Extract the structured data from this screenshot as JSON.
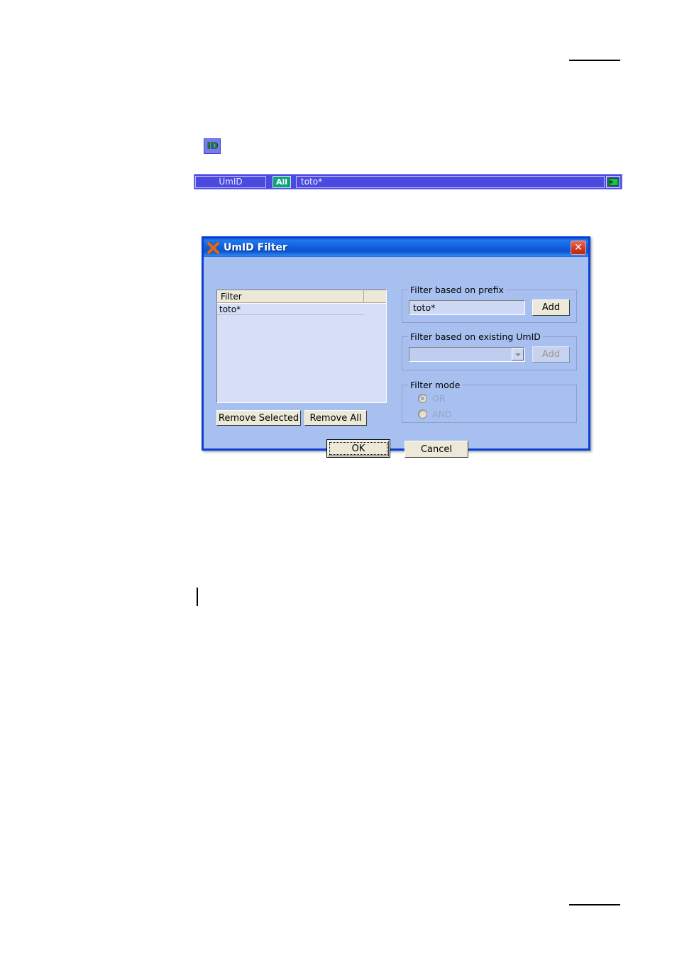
{
  "page": {
    "rules": [
      {
        "name": "top-rule"
      },
      {
        "name": "bottom-rule"
      }
    ],
    "change_bar": ""
  },
  "palette": {
    "id_button": {
      "label": "ID",
      "name": "id-icon",
      "bg": "#7a7aee",
      "fg": "#1f7a3f"
    }
  },
  "toolbar": {
    "field_label": "UmID",
    "scope_button": "All",
    "value": "toto*",
    "go_icon": "enter-arrow-icon",
    "bg": "#4a4ae0",
    "accent": "#0aa578"
  },
  "dialog": {
    "title": "UmID Filter",
    "title_icon": "app-icon",
    "close_label": "✕",
    "titlebar_color": "#1160e0",
    "body_color": "#a8c0f0",
    "list": {
      "columns": [
        "Filter",
        ""
      ],
      "rows": [
        [
          "toto*"
        ]
      ]
    },
    "buttons": {
      "remove_selected": "Remove Selected",
      "remove_all": "Remove All",
      "ok": "OK",
      "cancel": "Cancel"
    },
    "prefix_group": {
      "legend": "Filter based on prefix",
      "input_value": "toto*",
      "add_label": "Add"
    },
    "existing_group": {
      "legend": "Filter based on existing UmID",
      "combo_value": "",
      "add_label": "Add",
      "disabled": true
    },
    "mode_group": {
      "legend": "Filter mode",
      "options": [
        {
          "label": "OR",
          "selected": true
        },
        {
          "label": "AND",
          "selected": false
        }
      ],
      "disabled": true
    }
  }
}
